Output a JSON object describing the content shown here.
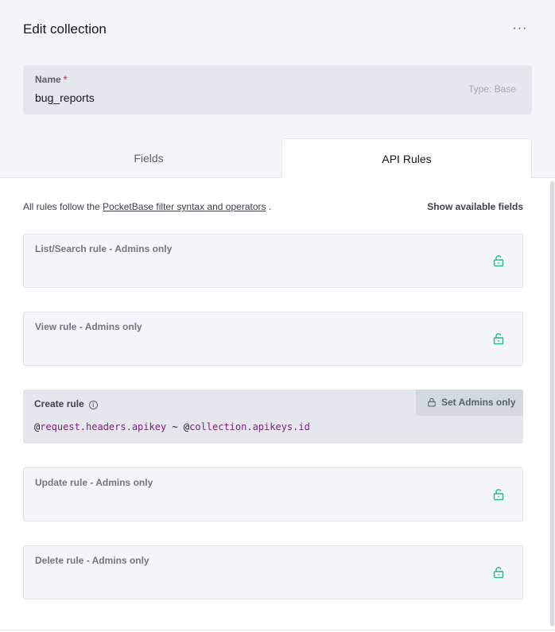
{
  "header": {
    "title": "Edit collection",
    "more_label": "···"
  },
  "name_field": {
    "label": "Name",
    "required_marker": "*",
    "value": "bug_reports",
    "type_tag": "Type: Base"
  },
  "tabs": [
    {
      "label": "Fields",
      "active": false
    },
    {
      "label": "API Rules",
      "active": true
    }
  ],
  "rules_note": {
    "prefix": "All rules follow the ",
    "link_text": "PocketBase filter syntax and operators",
    "suffix": " ."
  },
  "show_fields_label": "Show available fields",
  "rules": {
    "list": {
      "label": "List/Search rule - Admins only"
    },
    "view": {
      "label": "View rule - Admins only"
    },
    "create": {
      "label": "Create rule",
      "set_admins_label": "Set Admins only",
      "code_at1": "@",
      "code_part1": "request.headers.apikey",
      "code_op": " ~ ",
      "code_at2": "@",
      "code_part2": "collection.apikeys.id"
    },
    "update": {
      "label": "Update rule - Admins only"
    },
    "delete": {
      "label": "Delete rule - Admins only"
    }
  },
  "colors": {
    "unlock_icon": "#2fb58b",
    "keyword": "#7a1f78",
    "required": "#e34562"
  },
  "icons": {
    "more": "more-horizontal-icon",
    "unlock": "unlock-icon",
    "lock": "lock-icon",
    "info": "info-icon"
  }
}
